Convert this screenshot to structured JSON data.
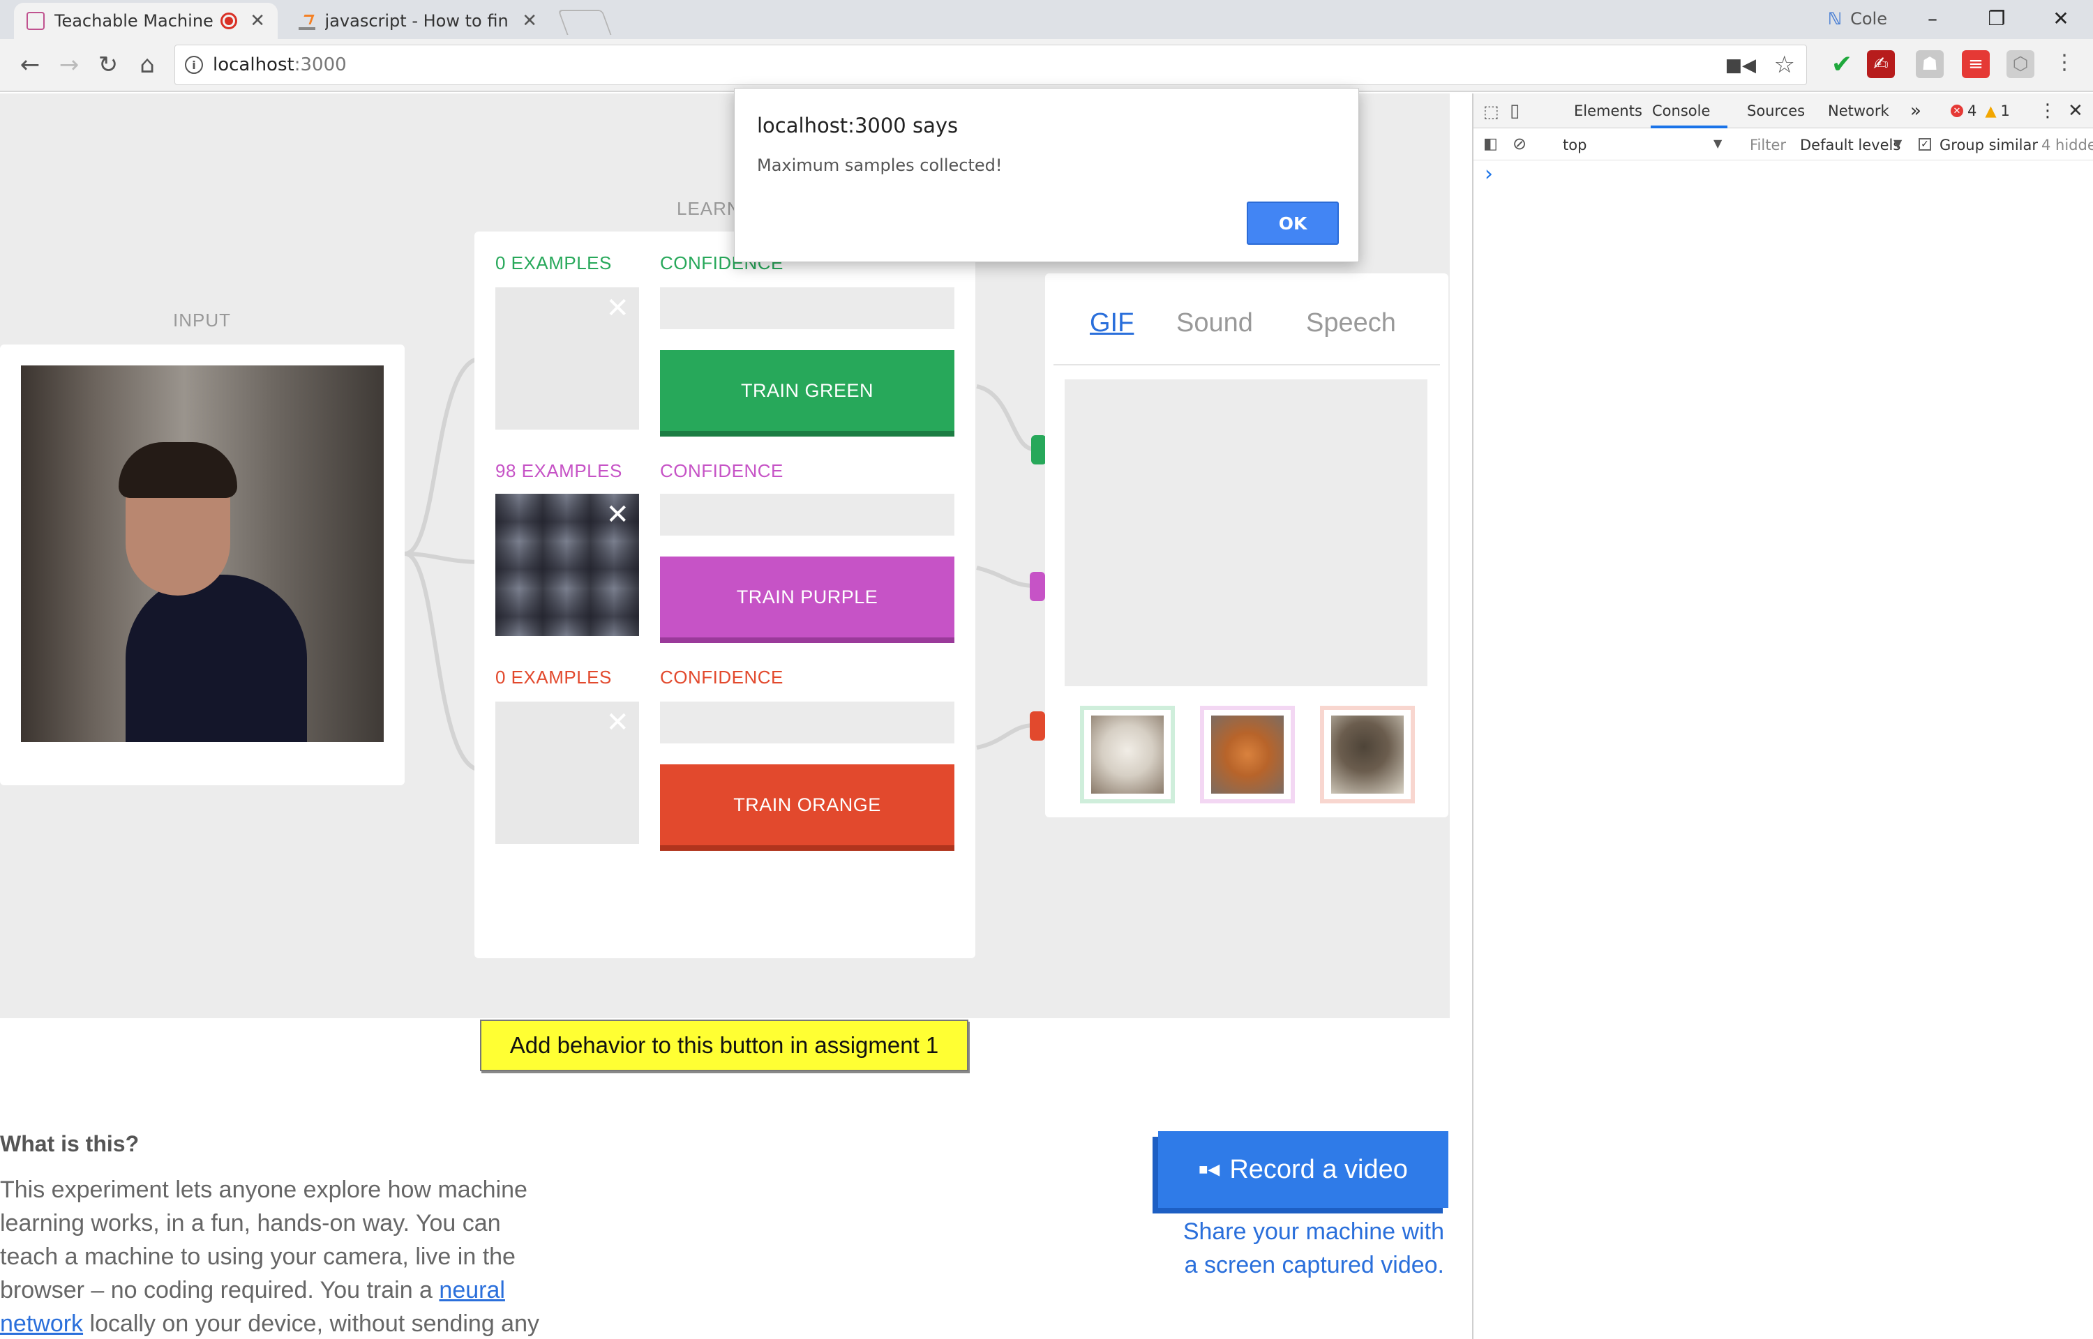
{
  "browser": {
    "tabs": [
      {
        "title": "Teachable Machine",
        "close": "✕"
      },
      {
        "title": "javascript - How to find t",
        "close": "✕"
      }
    ],
    "profile_name": "Cole",
    "window_controls": {
      "minimize": "–",
      "restore": "❐",
      "close": "✕"
    },
    "address": {
      "host": "localhost",
      "port": ":3000"
    },
    "colors": {
      "tabbar": "#dee1e6",
      "toolbar": "#f2f2f2"
    }
  },
  "dialog": {
    "title": "localhost:3000 says",
    "message": "Maximum samples collected!",
    "ok_label": "OK"
  },
  "page": {
    "input_label": "INPUT",
    "learning_label": "LEARN",
    "classes": [
      {
        "examples": "0 EXAMPLES",
        "confidence": "CONFIDENCE",
        "train": "TRAIN GREEN",
        "color": "#27a85a",
        "dark": "#1c7d43",
        "confidence_level": 0
      },
      {
        "examples": "98 EXAMPLES",
        "confidence": "CONFIDENCE",
        "train": "TRAIN PURPLE",
        "color": "#c653c6",
        "dark": "#9a3a9a",
        "confidence_level": 0
      },
      {
        "examples": "0 EXAMPLES",
        "confidence": "CONFIDENCE",
        "train": "TRAIN ORANGE",
        "color": "#e2492d",
        "dark": "#b0341d",
        "confidence_level": 0
      }
    ],
    "output_tabs": [
      {
        "label": "GIF"
      },
      {
        "label": "Sound"
      },
      {
        "label": "Speech"
      }
    ],
    "gif_icons": [
      "white-dog-icon",
      "orange-dog-icon",
      "cat-icon"
    ],
    "assignment_button": "Add behavior to this button in assigment 1",
    "what_heading": "What is this?",
    "desc_line1": "This experiment lets anyone explore how machine",
    "desc_line2": "learning works, in a fun, hands-on way. You can",
    "desc_line3": "teach a machine to using your camera, live in the",
    "desc_line4_pre": "browser – no coding required. You train a ",
    "desc_link1": "neural",
    "desc_link2": "network",
    "desc_line5_post": " locally on your device, without sending any",
    "record_label": "Record a video",
    "share_line1": "Share your machine with",
    "share_line2": "a screen captured video."
  },
  "devtools": {
    "tabs": [
      "Elements",
      "Console",
      "Sources",
      "Network"
    ],
    "more": "»",
    "errors": "4",
    "warnings": "1",
    "context": "top",
    "filter_placeholder": "Filter",
    "levels": "Default levels",
    "group_similar": "Group similar",
    "hidden": "4 hidde",
    "prompt": "›"
  }
}
